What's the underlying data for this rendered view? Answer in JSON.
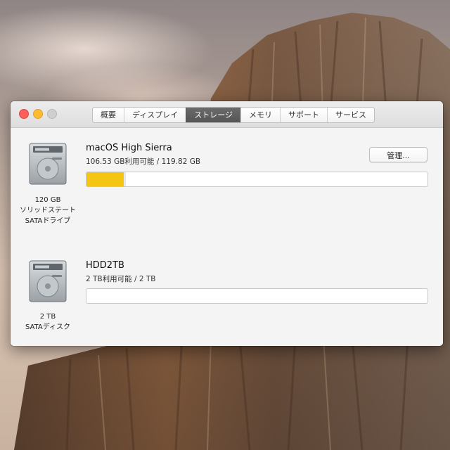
{
  "window": {
    "tabs": [
      {
        "label": "概要",
        "active": false
      },
      {
        "label": "ディスプレイ",
        "active": false
      },
      {
        "label": "ストレージ",
        "active": true
      },
      {
        "label": "メモリ",
        "active": false
      },
      {
        "label": "サポート",
        "active": false
      },
      {
        "label": "サービス",
        "active": false
      }
    ]
  },
  "drives": [
    {
      "capacity": "120 GB",
      "type_line1": "ソリッドステート",
      "type_line2": "SATAドライブ",
      "name": "macOS High Sierra",
      "usage": "106.53 GB利用可能 / 119.82 GB",
      "used_fraction": 0.11,
      "bar_color": "#f6c413",
      "manage_label": "管理..."
    },
    {
      "capacity": "2 TB",
      "type_line1": "SATAディスク",
      "name": "HDD2TB",
      "usage": "2 TB利用可能 / 2 TB",
      "used_fraction": 0.0
    }
  ],
  "icons": [
    "hard-drive-icon"
  ]
}
